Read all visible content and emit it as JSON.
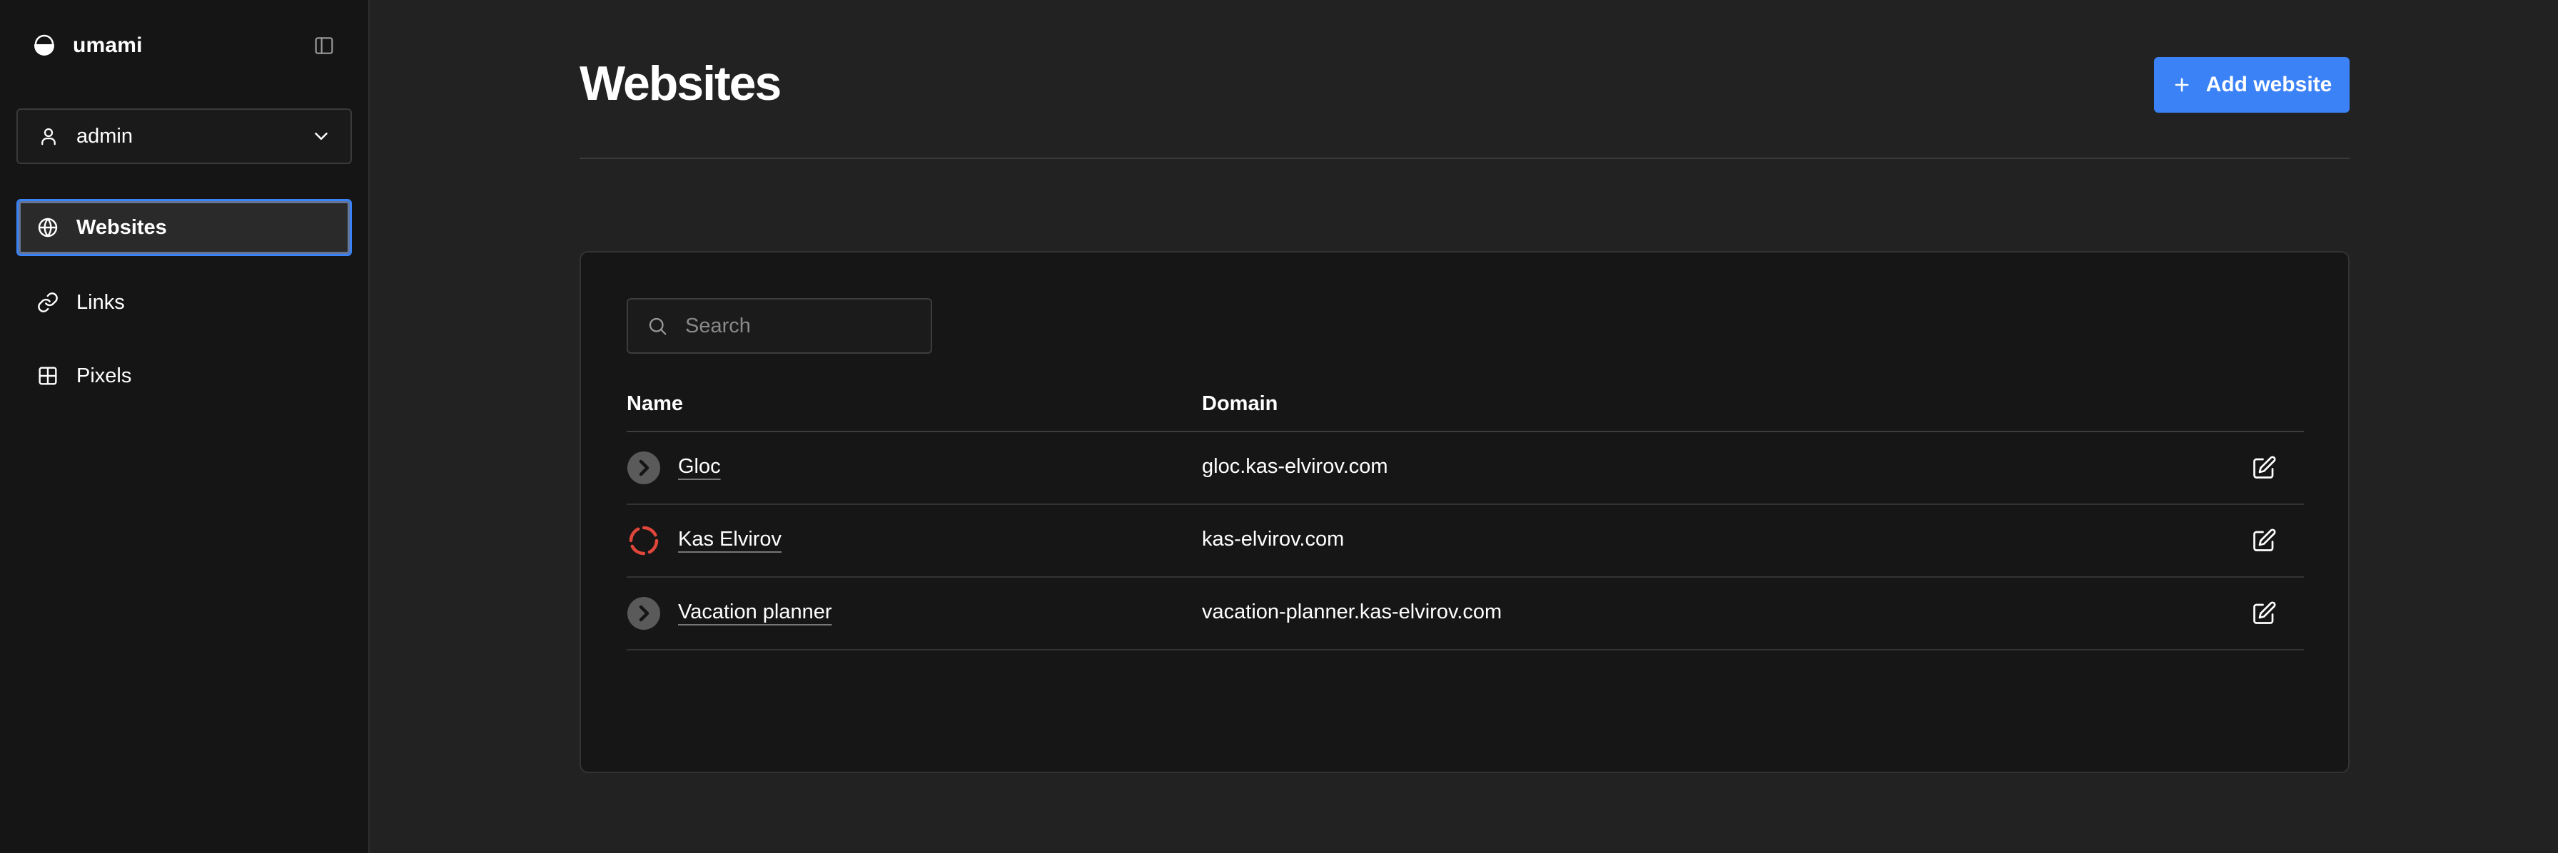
{
  "brand": {
    "name": "umami"
  },
  "user": {
    "label": "admin"
  },
  "nav": {
    "items": [
      {
        "label": "Websites",
        "icon": "globe-icon",
        "active": true
      },
      {
        "label": "Links",
        "icon": "link-icon",
        "active": false
      },
      {
        "label": "Pixels",
        "icon": "grid-icon",
        "active": false
      }
    ]
  },
  "page": {
    "title": "Websites",
    "add_button_label": "Add website"
  },
  "search": {
    "placeholder": "Search",
    "value": ""
  },
  "table": {
    "headers": {
      "name": "Name",
      "domain": "Domain"
    },
    "rows": [
      {
        "name": "Gloc",
        "domain": "gloc.kas-elvirov.com",
        "status_icon": "chevron-right-icon"
      },
      {
        "name": "Kas Elvirov",
        "domain": "kas-elvirov.com",
        "status_icon": "loading-spinner-icon"
      },
      {
        "name": "Vacation planner",
        "domain": "vacation-planner.kas-elvirov.com",
        "status_icon": "chevron-right-icon"
      }
    ]
  },
  "colors": {
    "accent": "#3b82f6",
    "sidebar_bg": "#151515",
    "main_bg": "#222222",
    "card_bg": "#161616",
    "spinner": "#e0463a"
  }
}
